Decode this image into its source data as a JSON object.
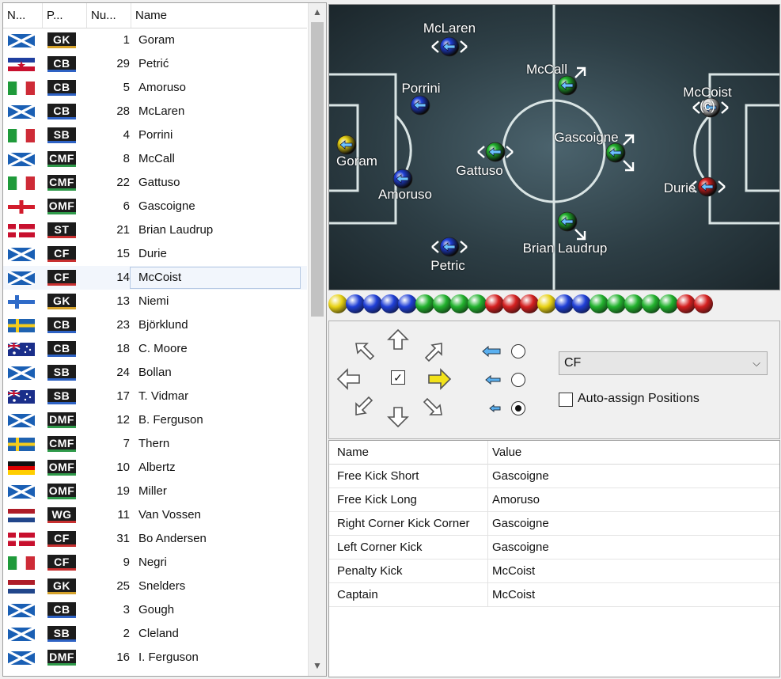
{
  "roster": {
    "columns": [
      "N...",
      "P...",
      "Nu...",
      "Name"
    ],
    "rows": [
      {
        "flag": "scotland",
        "pos": "GK",
        "num": "1",
        "name": "Goram"
      },
      {
        "flag": "yugoslavia",
        "pos": "CB",
        "num": "29",
        "name": "Petrić"
      },
      {
        "flag": "italy",
        "pos": "CB",
        "num": "5",
        "name": "Amoruso"
      },
      {
        "flag": "scotland",
        "pos": "CB",
        "num": "28",
        "name": "McLaren"
      },
      {
        "flag": "italy",
        "pos": "SB",
        "num": "4",
        "name": "Porrini"
      },
      {
        "flag": "scotland",
        "pos": "CMF",
        "num": "8",
        "name": "McCall"
      },
      {
        "flag": "italy",
        "pos": "CMF",
        "num": "22",
        "name": "Gattuso"
      },
      {
        "flag": "england",
        "pos": "OMF",
        "num": "6",
        "name": "Gascoigne"
      },
      {
        "flag": "denmark",
        "pos": "ST",
        "num": "21",
        "name": "Brian Laudrup"
      },
      {
        "flag": "scotland",
        "pos": "CF",
        "num": "15",
        "name": "Durie"
      },
      {
        "flag": "scotland",
        "pos": "CF",
        "num": "14",
        "name": "McCoist",
        "selected": true
      },
      {
        "flag": "finland",
        "pos": "GK",
        "num": "13",
        "name": "Niemi"
      },
      {
        "flag": "sweden",
        "pos": "CB",
        "num": "23",
        "name": "Björklund"
      },
      {
        "flag": "australia",
        "pos": "CB",
        "num": "18",
        "name": "C. Moore"
      },
      {
        "flag": "scotland",
        "pos": "SB",
        "num": "24",
        "name": "Bollan"
      },
      {
        "flag": "australia",
        "pos": "SB",
        "num": "17",
        "name": "T. Vidmar"
      },
      {
        "flag": "scotland",
        "pos": "DMF",
        "num": "12",
        "name": "B. Ferguson"
      },
      {
        "flag": "sweden",
        "pos": "CMF",
        "num": "7",
        "name": "Thern"
      },
      {
        "flag": "germany",
        "pos": "OMF",
        "num": "10",
        "name": "Albertz"
      },
      {
        "flag": "scotland",
        "pos": "OMF",
        "num": "19",
        "name": "Miller"
      },
      {
        "flag": "netherlands",
        "pos": "WG",
        "num": "11",
        "name": "Van Vossen"
      },
      {
        "flag": "denmark",
        "pos": "CF",
        "num": "31",
        "name": "Bo Andersen"
      },
      {
        "flag": "italy",
        "pos": "CF",
        "num": "9",
        "name": "Negri"
      },
      {
        "flag": "netherlands",
        "pos": "GK",
        "num": "25",
        "name": "Snelders"
      },
      {
        "flag": "scotland",
        "pos": "CB",
        "num": "3",
        "name": "Gough"
      },
      {
        "flag": "scotland",
        "pos": "SB",
        "num": "2",
        "name": "Cleland"
      },
      {
        "flag": "scotland",
        "pos": "DMF",
        "num": "16",
        "name": "I. Ferguson"
      }
    ]
  },
  "pitch": {
    "players": [
      {
        "name": "McLaren",
        "color": "blue"
      },
      {
        "name": "McCall",
        "color": "green"
      },
      {
        "name": "Porrini",
        "color": "blue"
      },
      {
        "name": "McCoist (c)",
        "color": "white"
      },
      {
        "name": "Goram",
        "color": "yellow"
      },
      {
        "name": "Gattuso",
        "color": "green"
      },
      {
        "name": "Gascoigne",
        "color": "green"
      },
      {
        "name": "Amoruso",
        "color": "blue"
      },
      {
        "name": "Durie",
        "color": "red"
      },
      {
        "name": "Brian Laudrup",
        "color": "green"
      },
      {
        "name": "Petric",
        "color": "blue"
      }
    ]
  },
  "ball_strip": [
    "yellow",
    "blue",
    "blue",
    "blue",
    "blue",
    "green",
    "green",
    "green",
    "green",
    "red",
    "red",
    "red",
    "yellow",
    "blue",
    "blue",
    "green",
    "green",
    "green",
    "green",
    "green",
    "red",
    "red"
  ],
  "colors": {
    "yellow": "#e8d214",
    "blue": "#1f3fd6",
    "green": "#22b22e",
    "red": "#d42020",
    "white": "#e8e8e8"
  },
  "controls": {
    "position_select": "CF",
    "auto_assign_label": "Auto-assign Positions",
    "auto_assign_checked": false,
    "center_checkbox_checked": true,
    "radio_selected_index": 2
  },
  "properties": {
    "headers": [
      "Name",
      "Value"
    ],
    "rows": [
      {
        "name": "Free Kick Short",
        "value": "Gascoigne"
      },
      {
        "name": "Free Kick Long",
        "value": "Amoruso"
      },
      {
        "name": "Right Corner Kick Corner",
        "value": "Gascoigne"
      },
      {
        "name": "Left Corner Kick",
        "value": "Gascoigne"
      },
      {
        "name": "Penalty Kick",
        "value": "McCoist"
      },
      {
        "name": "Captain",
        "value": "McCoist"
      }
    ]
  }
}
